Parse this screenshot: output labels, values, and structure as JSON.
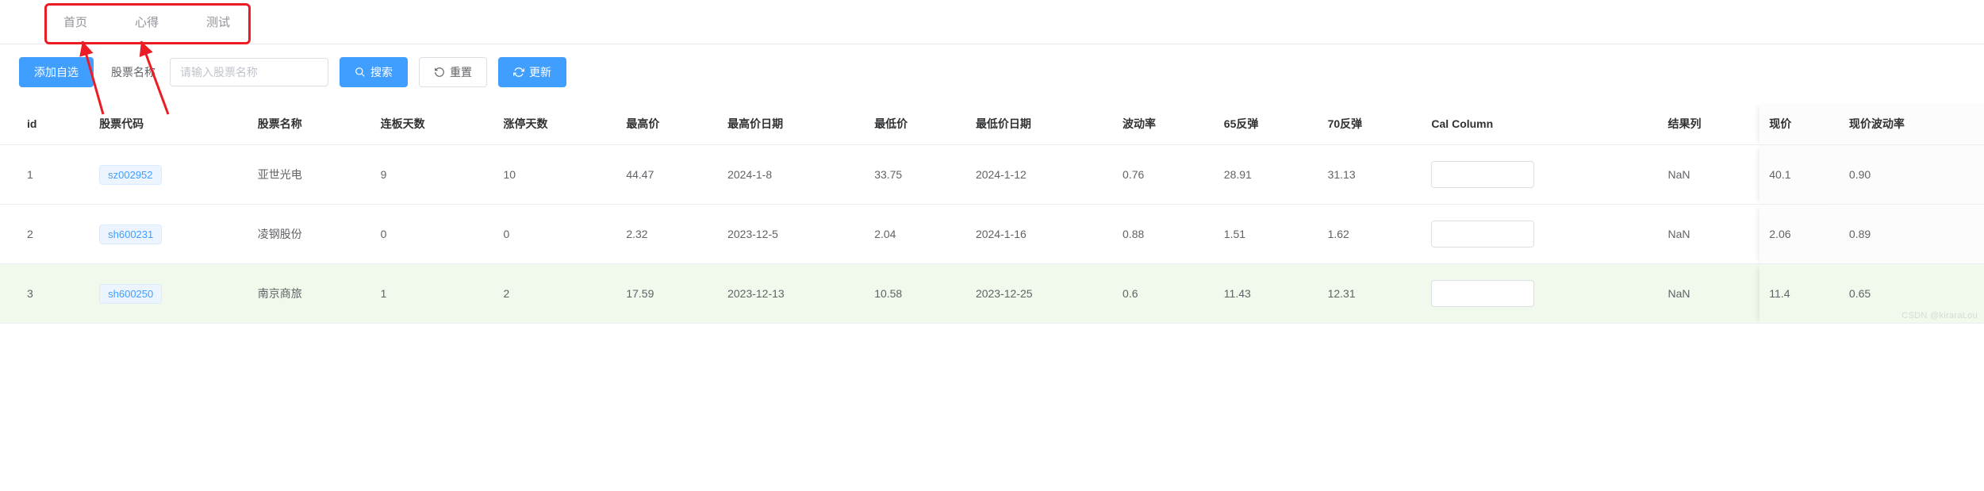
{
  "nav": {
    "tabs": [
      {
        "id": "home",
        "label": "首页"
      },
      {
        "id": "notes",
        "label": "心得"
      },
      {
        "id": "test",
        "label": "测试"
      }
    ]
  },
  "toolbar": {
    "add_label": "添加自选",
    "name_label": "股票名称",
    "name_placeholder": "请输入股票名称",
    "search_label": "搜索",
    "reset_label": "重置",
    "refresh_label": "更新"
  },
  "table": {
    "columns": {
      "id": "id",
      "code": "股票代码",
      "name": "股票名称",
      "lb_days": "连板天数",
      "zt_days": "涨停天数",
      "high": "最高价",
      "high_date": "最高价日期",
      "low": "最低价",
      "low_date": "最低价日期",
      "vol": "波动率",
      "r65": "65反弹",
      "r70": "70反弹",
      "cal": "Cal Column",
      "result": "结果列",
      "price": "现价",
      "price_vol": "现价波动率"
    },
    "rows": [
      {
        "id": "1",
        "code": "sz002952",
        "name": "亚世光电",
        "lb": "9",
        "zt": "10",
        "high": "44.47",
        "high_date": "2024-1-8",
        "low": "33.75",
        "low_date": "2024-1-12",
        "vol": "0.76",
        "r65": "28.91",
        "r70": "31.13",
        "cal": "",
        "result": "NaN",
        "price": "40.1",
        "price_vol": "0.90"
      },
      {
        "id": "2",
        "code": "sh600231",
        "name": "凌钢股份",
        "lb": "0",
        "zt": "0",
        "high": "2.32",
        "high_date": "2023-12-5",
        "low": "2.04",
        "low_date": "2024-1-16",
        "vol": "0.88",
        "r65": "1.51",
        "r70": "1.62",
        "cal": "",
        "result": "NaN",
        "price": "2.06",
        "price_vol": "0.89"
      },
      {
        "id": "3",
        "code": "sh600250",
        "name": "南京商旅",
        "lb": "1",
        "zt": "2",
        "high": "17.59",
        "high_date": "2023-12-13",
        "low": "10.58",
        "low_date": "2023-12-25",
        "vol": "0.6",
        "r65": "11.43",
        "r70": "12.31",
        "cal": "",
        "result": "NaN",
        "price": "11.4",
        "price_vol": "0.65"
      }
    ]
  },
  "watermark": "CSDN @kiraraLou"
}
